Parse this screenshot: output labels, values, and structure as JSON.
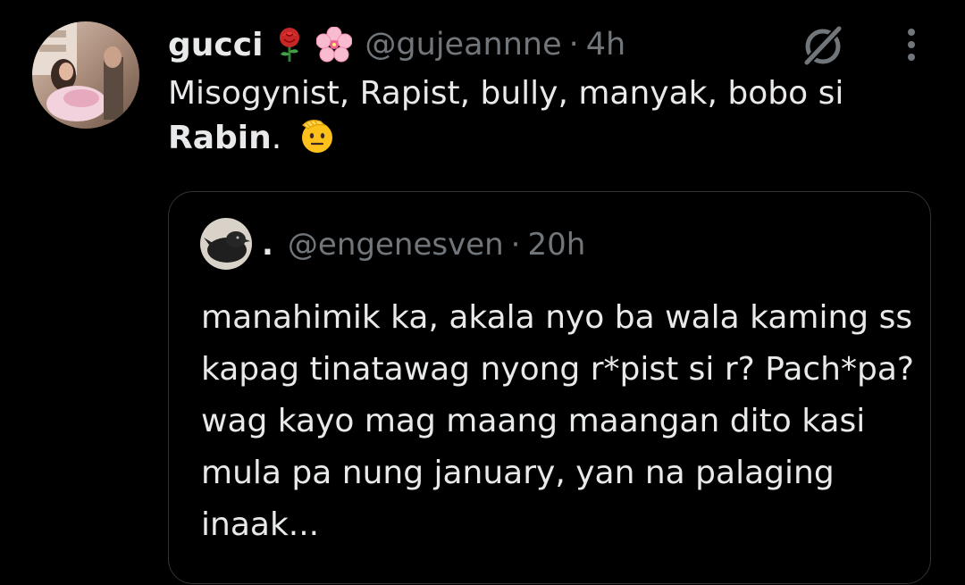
{
  "tweet": {
    "display_name": "gucci",
    "handle": "@gujeannne",
    "separator": "·",
    "time": "4h",
    "text_plain": "Misogynist, Rapist, bully, manyak, bobo si",
    "text_bold": "Rabin",
    "text_end": ".",
    "name_emojis": [
      "rose-emoji",
      "cherry-blossom-emoji"
    ],
    "text_emoji": "saluting-face-emoji"
  },
  "quote": {
    "display_name": ".",
    "handle": "@engenesven",
    "separator": "·",
    "time": "20h",
    "text": "manahimik ka, akala nyo ba wala kaming ss kapag tinatawag nyong r*pist si r? Pach*pa? wag kayo mag maang maangan dito kasi mula pa nung january, yan na palaging inaak..."
  },
  "icons": {
    "grok": "grok-icon",
    "more": "more-options-icon"
  },
  "colors": {
    "background": "#000000",
    "primary_text": "#e7e9ea",
    "secondary_text": "#71767b",
    "border": "#2f3336"
  }
}
